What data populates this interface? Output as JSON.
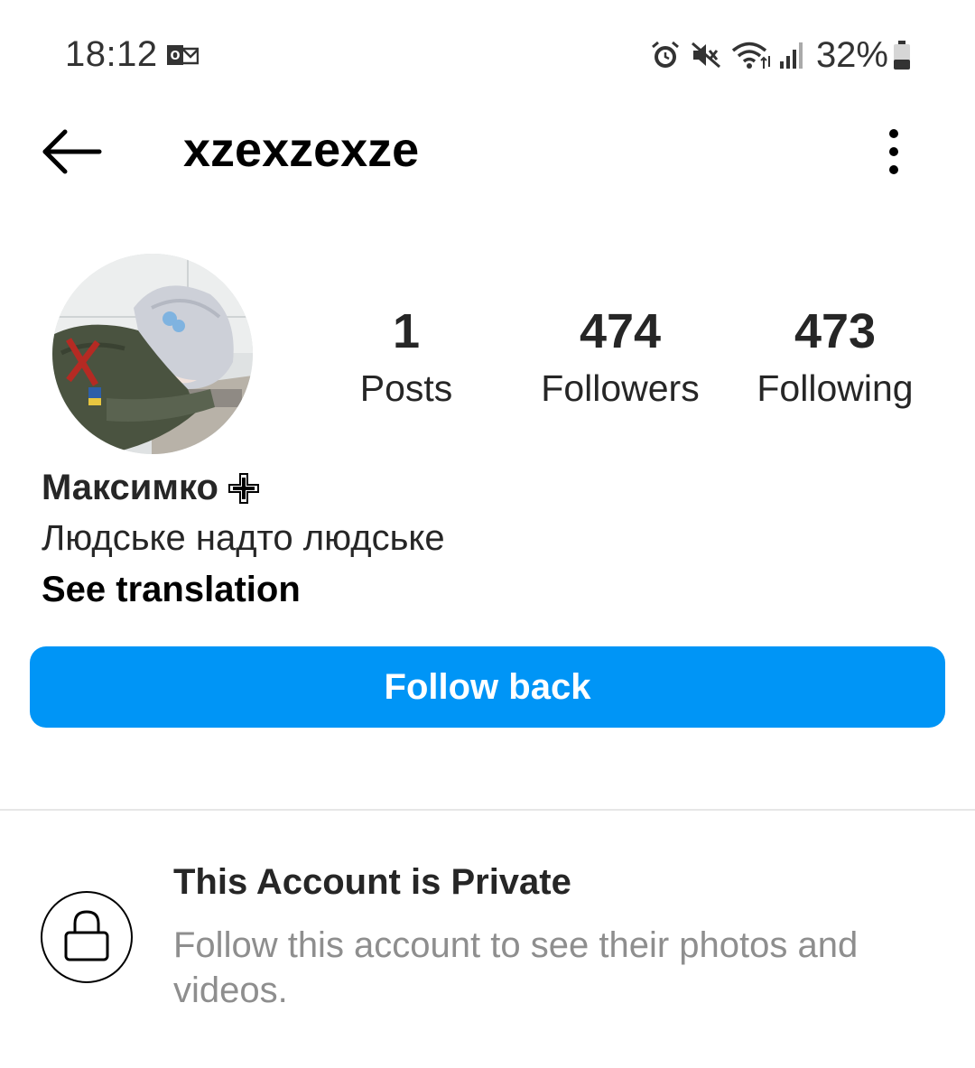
{
  "status_bar": {
    "time": "18:12",
    "notification_icon": "outlook-icon",
    "icons": [
      "alarm-icon",
      "mute-icon",
      "wifi-icon",
      "signal-icon",
      "battery-icon"
    ],
    "battery": "32%"
  },
  "header": {
    "username": "xzexzexze",
    "back_icon": "back-arrow-icon",
    "menu_icon": "more-vertical-icon"
  },
  "profile": {
    "stats": [
      {
        "value": "1",
        "label": "Posts"
      },
      {
        "value": "474",
        "label": "Followers"
      },
      {
        "value": "473",
        "label": "Following"
      }
    ],
    "display_name": "Максимко",
    "display_name_emoji_icon": "cross-icon",
    "bio": "Людське надто людське",
    "see_translation": "See translation"
  },
  "actions": {
    "follow_back": "Follow back"
  },
  "private_notice": {
    "icon": "lock-icon",
    "title": "This Account is Private",
    "description": "Follow this account to see their photos and videos."
  },
  "colors": {
    "accent": "#0095f6",
    "text_primary": "#262626",
    "text_secondary": "#8e8e8e",
    "divider": "#e6e6e6"
  }
}
